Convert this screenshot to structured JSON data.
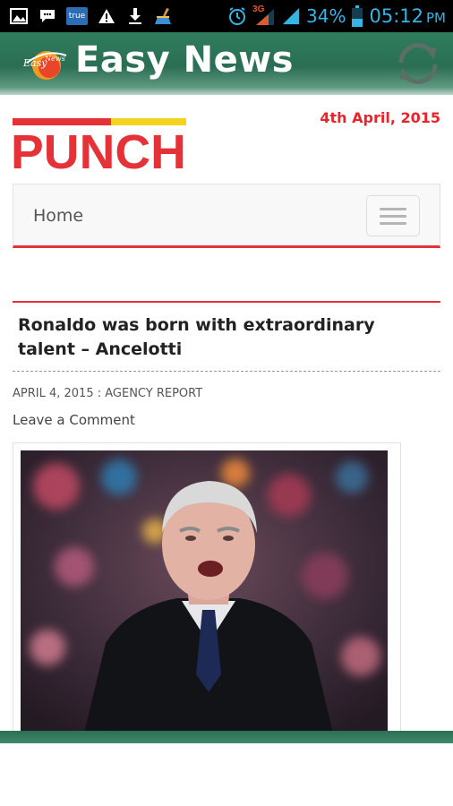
{
  "status_bar": {
    "battery_percent": "34%",
    "time": "05:12",
    "ampm": "PM",
    "network_type": "3G",
    "true_badge": "true"
  },
  "app": {
    "title": "Easy News",
    "logo_text": "EasyNews",
    "brand_color": "#2b6e53"
  },
  "page": {
    "date": "4th April, 2015",
    "publication": "PUNCH",
    "accent_color": "#e53238"
  },
  "nav": {
    "home_label": "Home"
  },
  "article": {
    "headline": "Ronaldo was born with extraordinary talent – Ancelotti",
    "meta": "APRIL 4, 2015 : AGENCY REPORT",
    "comment_link": "Leave a Comment"
  }
}
